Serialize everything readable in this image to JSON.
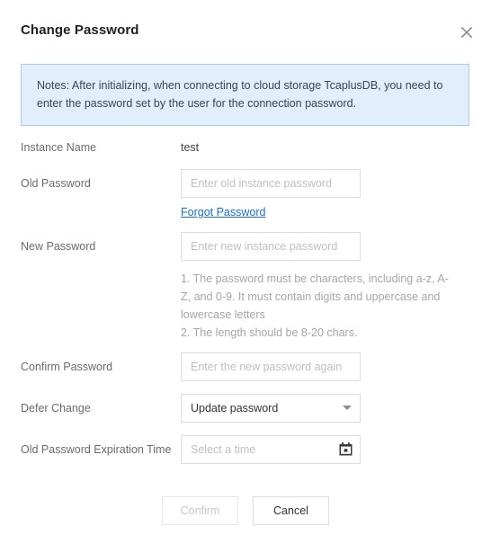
{
  "dialog": {
    "title": "Change Password",
    "close_icon": "close-icon"
  },
  "notice": {
    "text": "Notes: After initializing, when connecting to cloud storage TcaplusDB, you need to enter the password set by the user for the connection password.",
    "background": "#e3eefc",
    "border_color": "#a8ccf0",
    "text_color": "#35455a"
  },
  "form": {
    "instance_name": {
      "label": "Instance Name",
      "value": "test"
    },
    "old_password": {
      "label": "Old Password",
      "placeholder": "Enter old instance password",
      "value": ""
    },
    "forgot_password": {
      "label": "Forgot Password",
      "color": "#1a6dde"
    },
    "new_password": {
      "label": "New Password",
      "placeholder": "Enter new instance password",
      "value": "",
      "hint_line_1": "1. The password must be characters, including a-z, A-Z, and 0-9. It must contain digits and uppercase and lowercase letters",
      "hint_line_2": "2. The length should be 8-20 chars."
    },
    "confirm_password": {
      "label": "Confirm Password",
      "placeholder": "Enter the new password again",
      "value": ""
    },
    "defer_change": {
      "label": "Defer Change",
      "selected": "Update password",
      "caret_icon": "chevron-down-icon"
    },
    "expiration_time": {
      "label": "Old Password Expiration Time",
      "placeholder": "Select a time",
      "value": "",
      "calendar_icon": "calendar-icon"
    }
  },
  "footer": {
    "confirm_label": "Confirm",
    "confirm_disabled": true,
    "cancel_label": "Cancel"
  }
}
